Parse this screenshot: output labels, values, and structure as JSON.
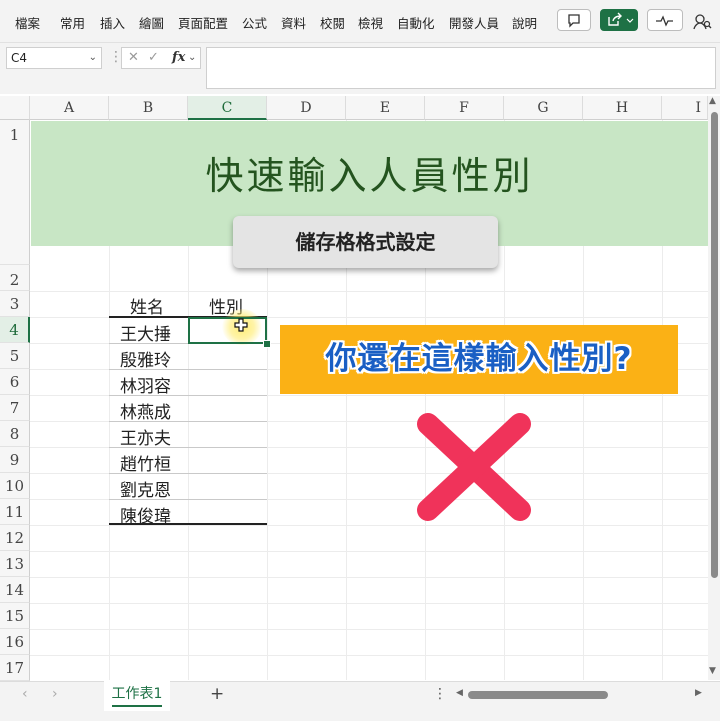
{
  "ribbon": {
    "tabs": [
      "檔案",
      "常用",
      "插入",
      "繪圖",
      "頁面配置",
      "公式",
      "資料",
      "校閱",
      "檢視",
      "自動化",
      "開發人員",
      "說明"
    ]
  },
  "formula_bar": {
    "name_box": "C4",
    "fx_label": "fx",
    "formula": ""
  },
  "grid": {
    "columns": [
      "A",
      "B",
      "C",
      "D",
      "E",
      "F",
      "G",
      "H",
      "I"
    ],
    "selected_column": "C",
    "rows": [
      "1",
      "2",
      "3",
      "4",
      "5",
      "6",
      "7",
      "8",
      "9",
      "10",
      "11",
      "12",
      "13",
      "14",
      "15",
      "16",
      "17"
    ],
    "selected_row": "4"
  },
  "banner": {
    "title": "快速輸入人員性別",
    "subtitle": "儲存格格式設定"
  },
  "table": {
    "headers": {
      "name": "姓名",
      "gender": "性別"
    },
    "names": [
      "王大捶",
      "殷雅玲",
      "林羽容",
      "林燕成",
      "王亦夫",
      "趙竹桓",
      "劉克恩",
      "陳俊瑋"
    ]
  },
  "callout": {
    "text": "你還在這樣輸入性別?",
    "mark": "x-mark-icon"
  },
  "sheet": {
    "tab_label": "工作表1",
    "add_label": "+"
  },
  "colors": {
    "accent": "#1e7145",
    "banner_bg": "#c8e6c5",
    "callout_bg": "#fbb115",
    "callout_text": "#1a5fc4",
    "x_mark": "#f0335a"
  }
}
